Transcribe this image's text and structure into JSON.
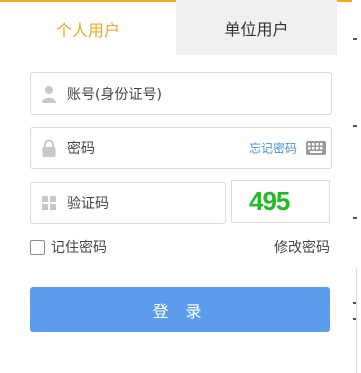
{
  "tabs": [
    {
      "label": "个人用户",
      "active": true
    },
    {
      "label": "单位用户",
      "active": false
    }
  ],
  "form": {
    "account_placeholder": "账号(身份证号)",
    "password_placeholder": "密码",
    "forgot_password": "忘记密码",
    "captcha_placeholder": "验证码",
    "captcha_code": "495",
    "remember_label": "记住密码",
    "remember_checked": false,
    "change_password": "修改密码",
    "login_label": "登 录"
  },
  "colors": {
    "accent": "#f5a623",
    "button": "#5c9ced",
    "link": "#4a90e2",
    "captcha": "#22bb22"
  },
  "icons": {
    "account": "user-icon",
    "password": "lock-icon",
    "keyboard": "keyboard-icon",
    "captcha": "grid-icon"
  }
}
